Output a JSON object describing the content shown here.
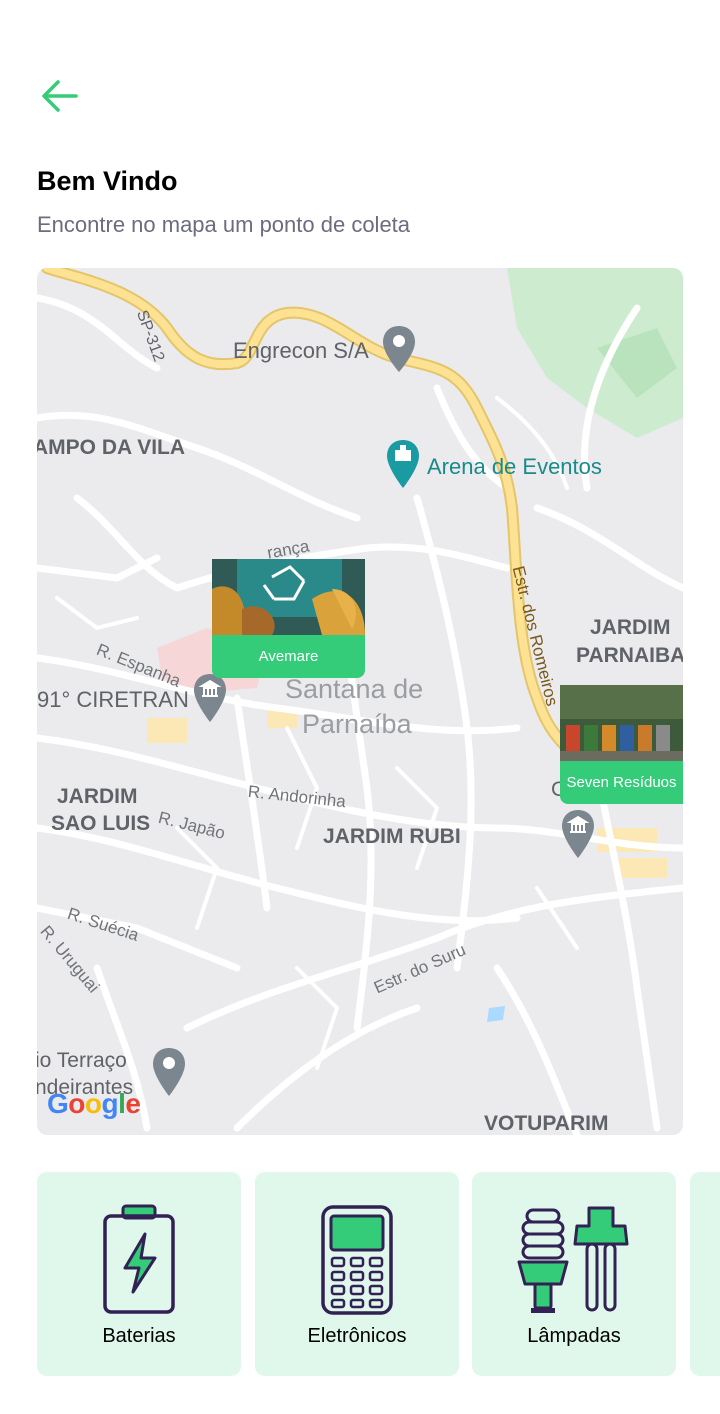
{
  "header": {
    "back_icon": "arrow-left-icon",
    "title": "Bem Vindo",
    "subtitle": "Encontre no mapa um ponto de coleta"
  },
  "map": {
    "labels": {
      "sp312": "SP-312",
      "engrecon": "Engrecon S/A",
      "campo_da_vila": "AMPO DA VILA",
      "arena": "Arena de Eventos",
      "franca": "rança",
      "estr_romeiros": "Estr. dos Romeiros",
      "jardim_parnaiba_1": "JARDIM",
      "jardim_parnaiba_2": "PARNAIBA",
      "r_espanha": "R. Espanha",
      "ciretran": "91° CIRETRAN",
      "santana_1": "Santana de",
      "santana_2": "Parnaíba",
      "jardim_sao_luis_1": "JARDIM",
      "jardim_sao_luis_2": "SAO LUIS",
      "r_japao": "R. Japão",
      "r_andorinha": "R. Andorinha",
      "jardim_rubi": "JARDIM RUBI",
      "r_suecia": "R. Suécia",
      "r_uruguai": "R. Uruguai",
      "estr_suru": "Estr. do Suru",
      "terraco_1": "io Terraço",
      "terraco_2": "ndeirantes",
      "votuparim": "VOTUPARIM",
      "c_letter": "C"
    },
    "markers": [
      {
        "name": "Avemare"
      },
      {
        "name": "Seven Resíduos"
      }
    ],
    "logo": [
      "G",
      "o",
      "o",
      "g",
      "l",
      "e"
    ]
  },
  "items": [
    {
      "label": "Baterias",
      "icon": "battery-icon"
    },
    {
      "label": "Eletrônicos",
      "icon": "electronics-icon"
    },
    {
      "label": "Lâmpadas",
      "icon": "lamps-icon"
    }
  ],
  "colors": {
    "accent": "#34cb79",
    "item_bg": "#e0f7ec",
    "icon_stroke": "#322153",
    "subtitle": "#6c6c80",
    "map_bg": "#ebebee",
    "road_highway": "#f7dc8a"
  }
}
